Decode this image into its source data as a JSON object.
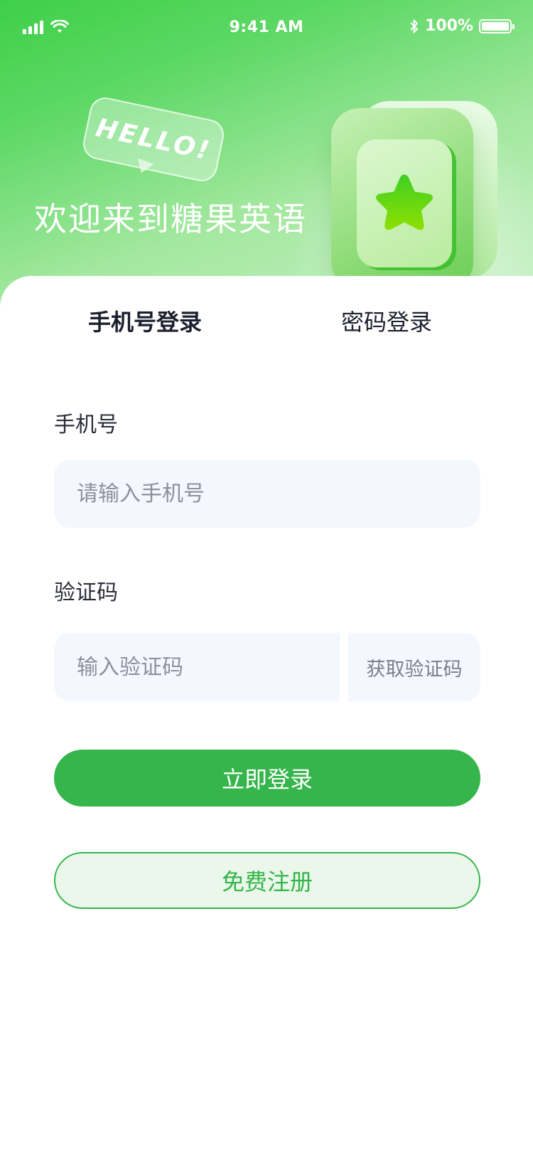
{
  "status_bar": {
    "time": "9:41 AM",
    "battery": "100%"
  },
  "hero": {
    "hello": "HELLO!",
    "welcome": "欢迎来到糖果英语"
  },
  "tabs": [
    {
      "label": "手机号登录",
      "active": true
    },
    {
      "label": "密码登录",
      "active": false
    }
  ],
  "form": {
    "phone_label": "手机号",
    "phone_placeholder": "请输入手机号",
    "code_label": "验证码",
    "code_placeholder": "输入验证码",
    "get_code": "获取验证码"
  },
  "buttons": {
    "login": "立即登录",
    "register": "免费注册"
  },
  "colors": {
    "primary": "#36b54c",
    "input_bg": "#f4f7fd",
    "register_bg": "#eaf7ea"
  },
  "icons": [
    "signal-icon",
    "wifi-icon",
    "bluetooth-icon",
    "battery-icon",
    "star-icon"
  ]
}
